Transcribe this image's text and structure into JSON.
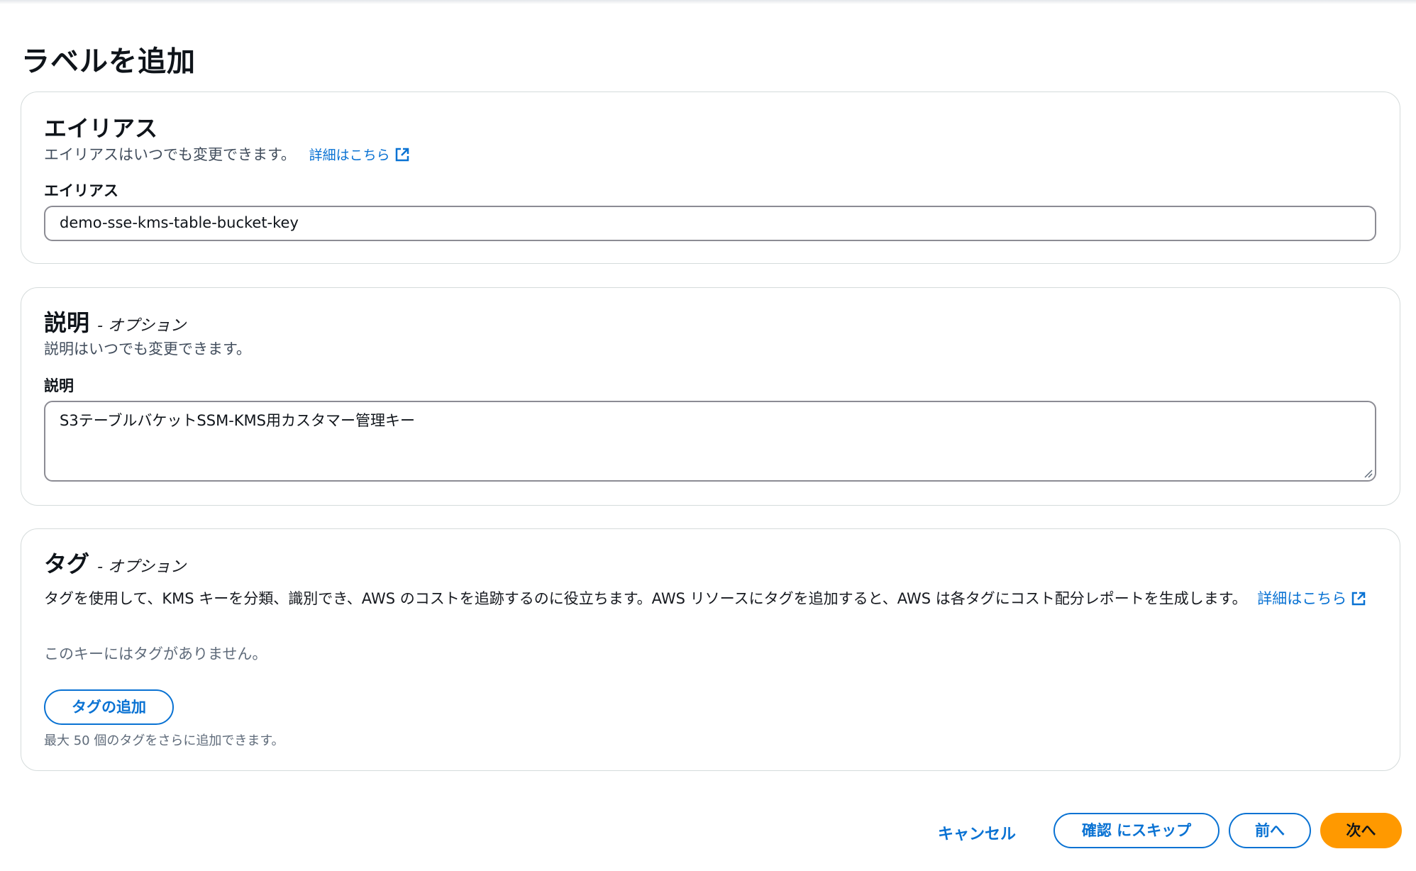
{
  "page": {
    "title": "ラベルを追加"
  },
  "alias_section": {
    "heading": "エイリアス",
    "description": "エイリアスはいつでも変更できます。",
    "learn_more": "詳細はこちら",
    "field_label": "エイリアス",
    "field_value": "demo-sse-kms-table-bucket-key"
  },
  "description_section": {
    "heading": "説明",
    "optional": "- オプション",
    "description": "説明はいつでも変更できます。",
    "field_label": "説明",
    "field_value": "S3テーブルバケットSSM-KMS用カスタマー管理キー"
  },
  "tags_section": {
    "heading": "タグ",
    "optional": "- オプション",
    "description": "タグを使用して、KMS キーを分類、識別でき、AWS のコストを追跡するのに役立ちます。AWS リソースにタグを追加すると、AWS は各タグにコスト配分レポートを生成します。",
    "learn_more": "詳細はこちら",
    "empty_message": "このキーにはタグがありません。",
    "add_button": "タグの追加",
    "limit_hint": "最大 50 個のタグをさらに追加できます。"
  },
  "footer": {
    "cancel": "キャンセル",
    "skip": "確認 にスキップ",
    "previous": "前へ",
    "next": "次へ"
  },
  "colors": {
    "link": "#0972d3",
    "primary": "#ff9900",
    "border": "#d5dbdb"
  },
  "icons": {
    "external_link": "external-link-icon"
  }
}
